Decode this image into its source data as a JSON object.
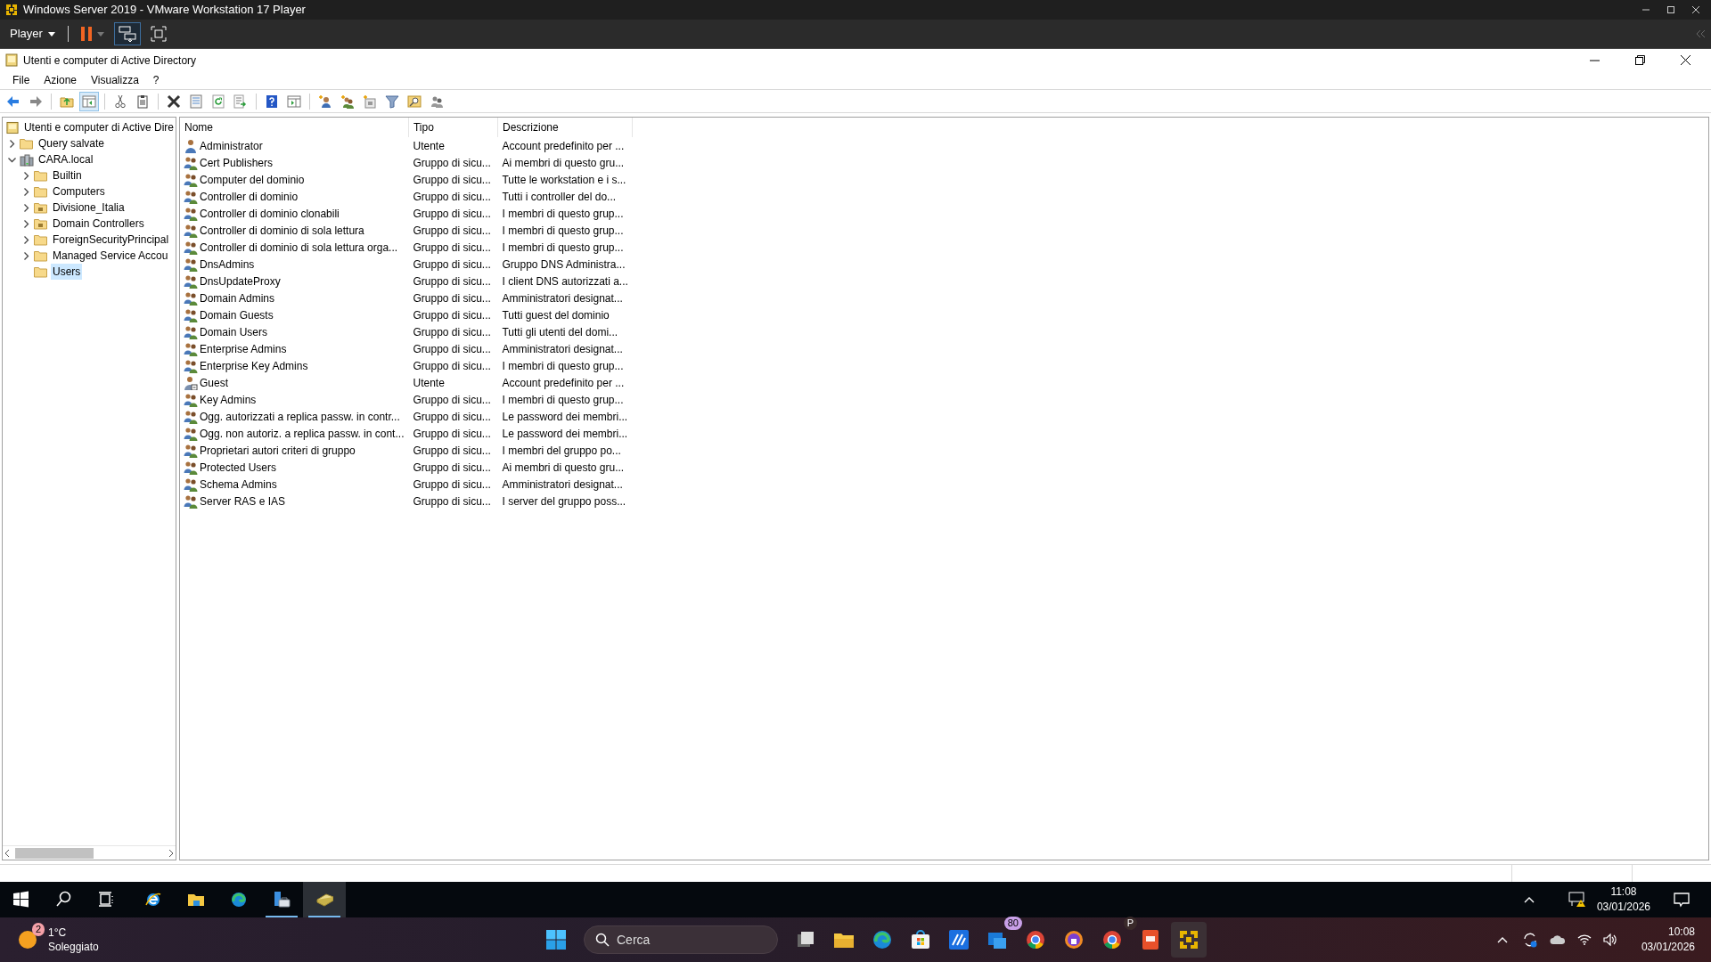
{
  "vmware": {
    "title": "Windows Server 2019 - VMware Workstation 17 Player",
    "player_menu": "Player"
  },
  "mmc": {
    "title": "Utenti e computer di Active Directory",
    "menu": [
      "File",
      "Azione",
      "Visualizza",
      "?"
    ],
    "tree": {
      "label": "Utenti e computer di Active Dire",
      "children": [
        {
          "label": "Query salvate",
          "kind": "folder",
          "expanded": false,
          "selected": false
        },
        {
          "label": "CARA.local",
          "kind": "domain",
          "expanded": true,
          "selected": false,
          "children": [
            {
              "label": "Builtin",
              "kind": "folder",
              "expanded": false,
              "selected": false
            },
            {
              "label": "Computers",
              "kind": "folder",
              "expanded": false,
              "selected": false
            },
            {
              "label": "Divisione_Italia",
              "kind": "ou",
              "expanded": false,
              "selected": false
            },
            {
              "label": "Domain Controllers",
              "kind": "ou",
              "expanded": false,
              "selected": false
            },
            {
              "label": "ForeignSecurityPrincipal",
              "kind": "folder",
              "expanded": false,
              "selected": false
            },
            {
              "label": "Managed Service Accou",
              "kind": "folder",
              "expanded": false,
              "selected": false
            },
            {
              "label": "Users",
              "kind": "folder",
              "selected": true
            }
          ]
        }
      ]
    },
    "list": {
      "columns": [
        "Nome",
        "Tipo",
        "Descrizione"
      ],
      "rows": [
        {
          "kind": "user",
          "name": "Administrator",
          "type": "Utente",
          "description": "Account predefinito per ..."
        },
        {
          "kind": "group",
          "name": "Cert Publishers",
          "type": "Gruppo di sicu...",
          "description": "Ai membri di questo gru..."
        },
        {
          "kind": "group",
          "name": "Computer del dominio",
          "type": "Gruppo di sicu...",
          "description": "Tutte le workstation e i s..."
        },
        {
          "kind": "group",
          "name": "Controller di dominio",
          "type": "Gruppo di sicu...",
          "description": "Tutti i controller del do..."
        },
        {
          "kind": "group",
          "name": "Controller di dominio clonabili",
          "type": "Gruppo di sicu...",
          "description": "I membri di questo grup..."
        },
        {
          "kind": "group",
          "name": "Controller di dominio di sola lettura",
          "type": "Gruppo di sicu...",
          "description": "I membri di questo grup..."
        },
        {
          "kind": "group",
          "name": "Controller di dominio di sola lettura orga...",
          "type": "Gruppo di sicu...",
          "description": "I membri di questo grup..."
        },
        {
          "kind": "group",
          "name": "DnsAdmins",
          "type": "Gruppo di sicu...",
          "description": "Gruppo DNS Administra..."
        },
        {
          "kind": "group",
          "name": "DnsUpdateProxy",
          "type": "Gruppo di sicu...",
          "description": "I client DNS autorizzati a..."
        },
        {
          "kind": "group",
          "name": "Domain Admins",
          "type": "Gruppo di sicu...",
          "description": "Amministratori designat..."
        },
        {
          "kind": "group",
          "name": "Domain Guests",
          "type": "Gruppo di sicu...",
          "description": "Tutti guest del dominio"
        },
        {
          "kind": "group",
          "name": "Domain Users",
          "type": "Gruppo di sicu...",
          "description": "Tutti gli utenti del domi..."
        },
        {
          "kind": "group",
          "name": "Enterprise Admins",
          "type": "Gruppo di sicu...",
          "description": "Amministratori designat..."
        },
        {
          "kind": "group",
          "name": "Enterprise Key Admins",
          "type": "Gruppo di sicu...",
          "description": "I membri di questo grup..."
        },
        {
          "kind": "user_disabled",
          "name": "Guest",
          "type": "Utente",
          "description": "Account predefinito per ..."
        },
        {
          "kind": "group",
          "name": "Key Admins",
          "type": "Gruppo di sicu...",
          "description": "I membri di questo grup..."
        },
        {
          "kind": "group",
          "name": "Ogg. autorizzati a replica passw. in contr...",
          "type": "Gruppo di sicu...",
          "description": "Le password dei membri..."
        },
        {
          "kind": "group",
          "name": "Ogg. non autoriz. a replica passw. in cont...",
          "type": "Gruppo di sicu...",
          "description": "Le password dei membri..."
        },
        {
          "kind": "group",
          "name": "Proprietari autori criteri di gruppo",
          "type": "Gruppo di sicu...",
          "description": "I membri del gruppo po..."
        },
        {
          "kind": "group",
          "name": "Protected Users",
          "type": "Gruppo di sicu...",
          "description": "Ai membri di questo gru..."
        },
        {
          "kind": "group",
          "name": "Schema Admins",
          "type": "Gruppo di sicu...",
          "description": "Amministratori designat..."
        },
        {
          "kind": "group",
          "name": "Server RAS e IAS",
          "type": "Gruppo di sicu...",
          "description": "I server del gruppo poss..."
        }
      ]
    }
  },
  "guest_taskbar": {
    "time": "11:08",
    "date": "03/01/2026"
  },
  "host_taskbar": {
    "weather_badge": "2",
    "temperature": "1°C",
    "condition": "Soleggiato",
    "search_placeholder": "Cerca",
    "mail_badge": "80",
    "profile_badge": "P",
    "time": "10:08",
    "date": "03/01/2026"
  }
}
